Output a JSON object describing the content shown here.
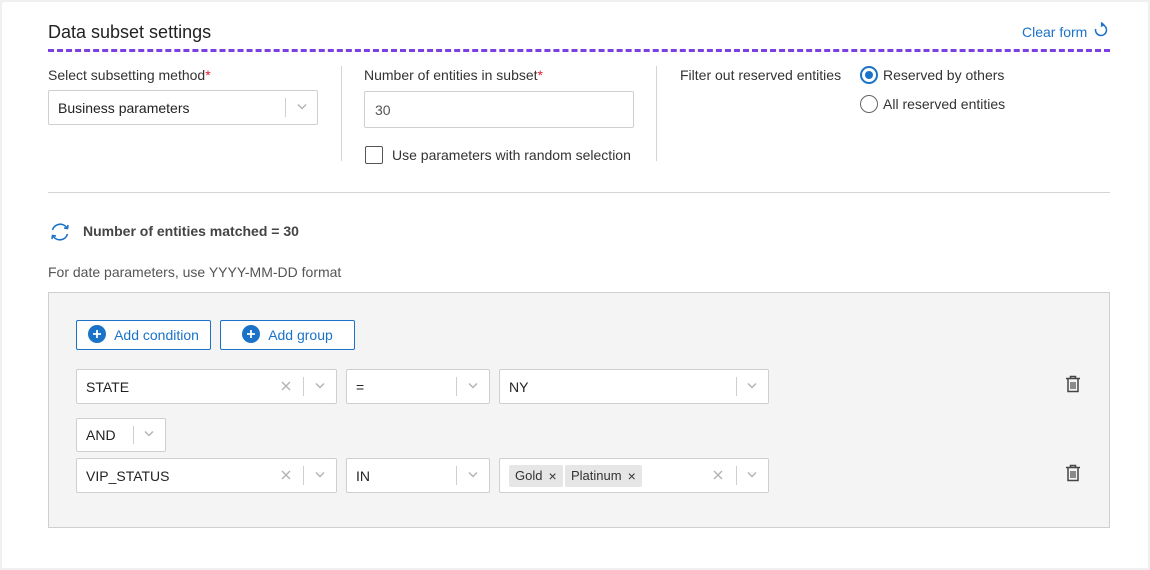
{
  "header": {
    "title": "Data subset settings",
    "clear_form_label": "Clear form"
  },
  "subsetting_method": {
    "label": "Select subsetting method",
    "required_mark": "*",
    "value": "Business parameters"
  },
  "entity_count": {
    "label": "Number of entities in subset",
    "required_mark": "*",
    "value": "30"
  },
  "random_selection": {
    "label": "Use parameters with random selection",
    "checked": false
  },
  "reserved_filter": {
    "label": "Filter out reserved entities",
    "options": [
      {
        "label": "Reserved by others",
        "selected": true
      },
      {
        "label": "All reserved entities",
        "selected": false
      }
    ]
  },
  "matched": {
    "text": "Number of entities matched = 30"
  },
  "date_hint": "For date parameters, use YYYY-MM-DD format",
  "conditions": {
    "add_condition_label": "Add condition",
    "add_group_label": "Add group",
    "rows": [
      {
        "field": "STATE",
        "operator": "=",
        "value": "NY"
      },
      {
        "field": "VIP_STATUS",
        "operator": "IN",
        "chips": [
          "Gold",
          "Platinum"
        ]
      }
    ],
    "connector": "AND"
  },
  "colors": {
    "accent": "#1a73c8",
    "dash": "#7b3fe4",
    "required": "#e0202a"
  }
}
